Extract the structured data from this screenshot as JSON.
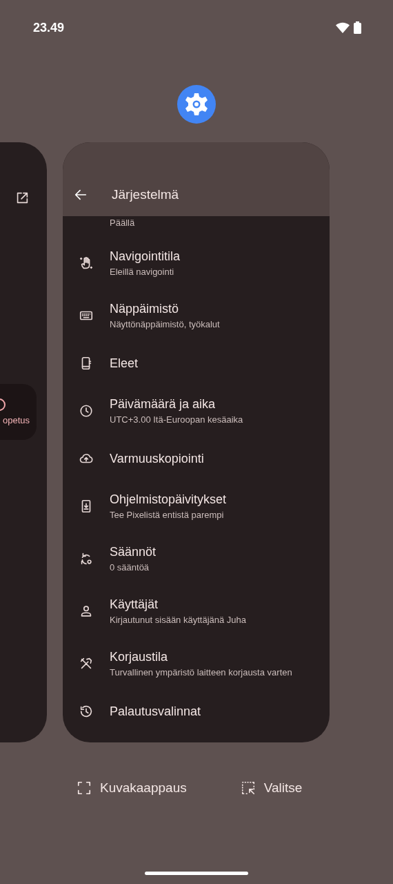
{
  "status_bar": {
    "time": "23.49"
  },
  "left_card": {
    "chip_label": "opetus"
  },
  "app_card": {
    "title": "Järjestelmä",
    "partial_item": {
      "subtitle": "Päällä"
    },
    "items": [
      {
        "title": "Navigointitila",
        "subtitle": "Eleillä navigointi"
      },
      {
        "title": "Näppäimistö",
        "subtitle": "Näyttönäppäimistö, työkalut"
      },
      {
        "title": "Eleet"
      },
      {
        "title": "Päivämäärä ja aika",
        "subtitle": "UTC+3.00 Itä-Euroopan kesäaika"
      },
      {
        "title": "Varmuuskopiointi"
      },
      {
        "title": "Ohjelmistopäivitykset",
        "subtitle": "Tee Pixelistä entistä parempi"
      },
      {
        "title": "Säännöt",
        "subtitle": "0 sääntöä"
      },
      {
        "title": "Käyttäjät",
        "subtitle": "Kirjautunut sisään käyttäjänä Juha"
      },
      {
        "title": "Korjaustila",
        "subtitle": "Turvallinen ympäristö laitteen korjausta varten"
      },
      {
        "title": "Palautusvalinnat"
      }
    ]
  },
  "actions": [
    {
      "label": "Kuvakaappaus"
    },
    {
      "label": "Valitse"
    }
  ]
}
